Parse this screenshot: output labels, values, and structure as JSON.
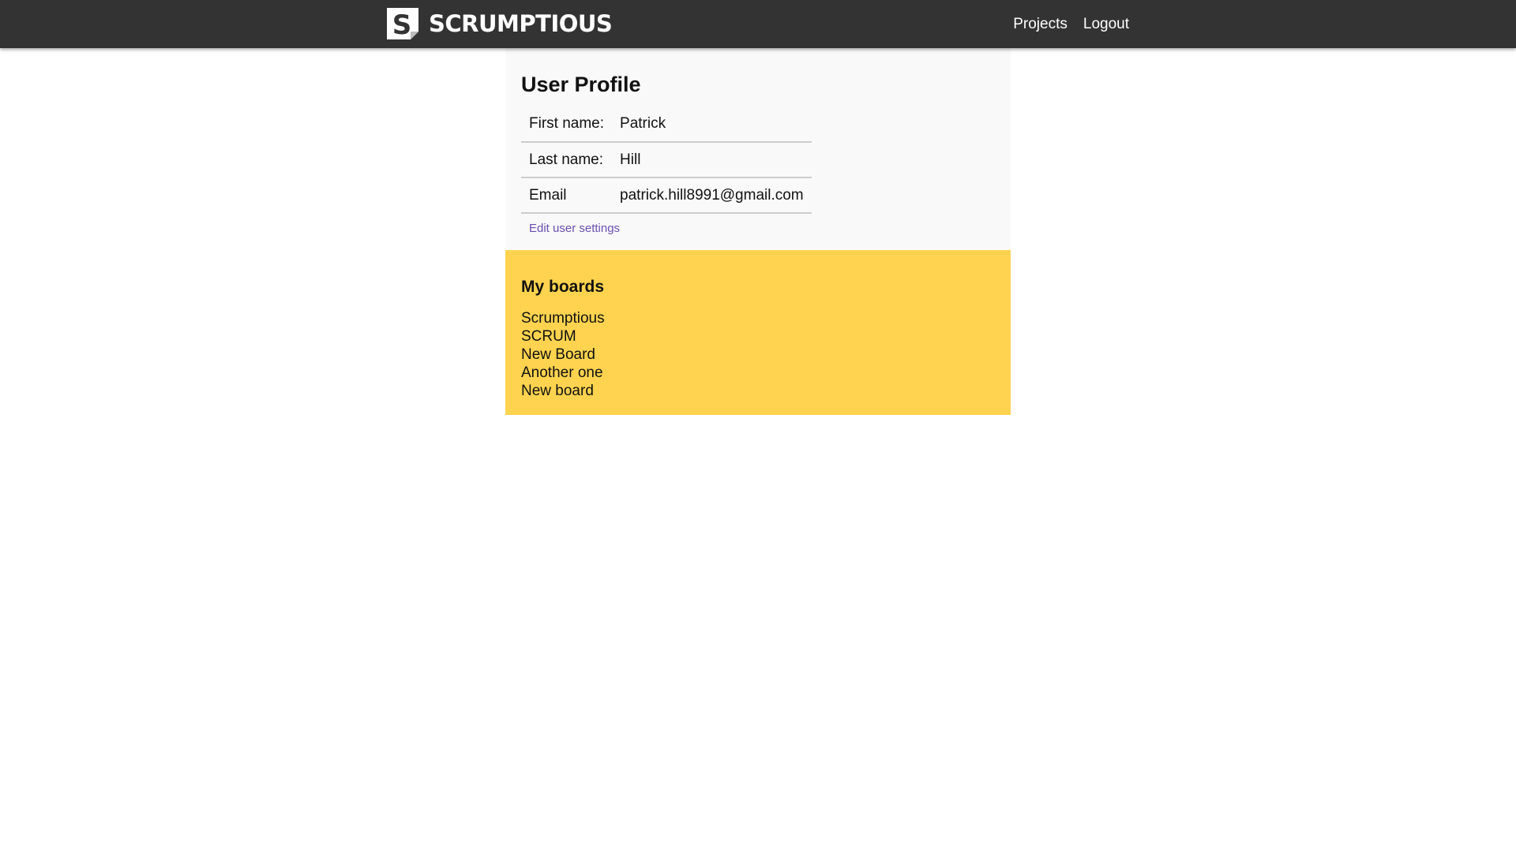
{
  "nav": {
    "brand": "SCRUMPTIOUS",
    "logo_icon": "scrumptious-logo-icon",
    "links": [
      "Projects",
      "Logout"
    ]
  },
  "profile": {
    "title": "User Profile",
    "rows": [
      {
        "label": "First name:",
        "value": "Patrick"
      },
      {
        "label": "Last name:",
        "value": "Hill"
      },
      {
        "label": "Email",
        "value": "patrick.hill8991@gmail.com"
      }
    ],
    "edit_link": "Edit user settings"
  },
  "boards": {
    "title": "My boards",
    "items": [
      "Scrumptious",
      "SCRUM",
      "New Board",
      "Another one",
      "New board"
    ]
  },
  "colors": {
    "nav_bg": "#333333",
    "profile_bg": "#f9f9f9",
    "boards_bg": "#ffd34f",
    "link": "#6a4fb0"
  }
}
